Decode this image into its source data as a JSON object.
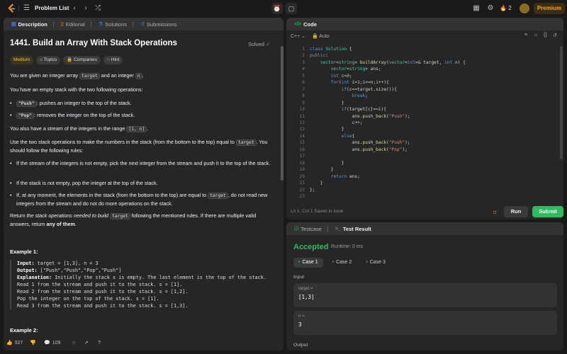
{
  "topbar": {
    "problem_list": "Problem List",
    "streak": "2",
    "premium": "Premium"
  },
  "left": {
    "tabs": [
      "Description",
      "Editorial",
      "Solutions",
      "Submissions"
    ],
    "title": "1441. Build an Array With Stack Operations",
    "solved": "Solved",
    "chips": [
      "Medium",
      "Topics",
      "Companies",
      "Hint"
    ],
    "p1_a": "You are given an integer array ",
    "p1_code1": "target",
    "p1_b": " and an integer ",
    "p1_code2": "n",
    "p1_c": ".",
    "p2": "You have an empty stack with the two following operations:",
    "b1_code": "\"Push\"",
    "b1_text": ": pushes an integer to the top of the stack.",
    "b2_code": "\"Pop\"",
    "b2_text": ": removes the integer on the top of the stack.",
    "p3_a": "You also have a stream of the integers in the range ",
    "p3_code": "[1, n]",
    "p3_b": ".",
    "p4_a": "Use the two stack operations to make the numbers in the stack (from the bottom to the top) equal to ",
    "p4_code": "target",
    "p4_b": ". You should follow the following rules:",
    "r1": "If the stream of the integers is not empty, pick the next integer from the stream and push it to the top of the stack.",
    "r2": "If the stack is not empty, pop the integer at the top of the stack.",
    "r3_a": "If, at any moment, the elements in the stack (from the bottom to the top) are equal to ",
    "r3_code": "target",
    "r3_b": ", do not read new integers from the stream and do not do more operations on the stack.",
    "p5_a": "Return ",
    "p5_em": "the stack operations needed to build ",
    "p5_code": "target",
    "p5_b": " following the mentioned rules. If there are multiple valid answers, return ",
    "p5_strong": "any of them",
    "p5_c": ".",
    "example1_title": "Example 1:",
    "example1_input_label": "Input:",
    "example1_input": " target = [1,3], n = 3",
    "example1_output_label": "Output:",
    "example1_output": " [\"Push\",\"Push\",\"Pop\",\"Push\"]",
    "example1_expl_label": "Explanation:",
    "example1_expl": " Initially the stack s is empty. The last element is the top of the stack.",
    "example1_l1": "Read 1 from the stream and push it to the stack. s = [1].",
    "example1_l2": "Read 2 from the stream and push it to the stack. s = [1,2].",
    "example1_l3": "Pop the integer on the top of the stack. s = [1].",
    "example1_l4": "Read 3 from the stream and push it to the stack. s = [1,3].",
    "example2_title": "Example 2:",
    "likes": "927",
    "comments": "109"
  },
  "code": {
    "tab": "Code",
    "lang": "C++",
    "auto": "Auto",
    "status": "Ln 1, Col 1    Saved to local",
    "run": "Run",
    "submit": "Submit",
    "line_numbers": [
      "1",
      "2",
      "3",
      "4",
      "5",
      "6",
      "7",
      "8",
      "9",
      "10",
      "11",
      "12",
      "13",
      "14",
      "15",
      "16",
      "17",
      "18",
      "19",
      "20",
      "21",
      "22",
      "23"
    ]
  },
  "result": {
    "tabs": [
      "Testcase",
      "Test Result"
    ],
    "accepted": "Accepted",
    "runtime": "Runtime: 0 ms",
    "cases": [
      "Case 1",
      "Case 2",
      "Case 3"
    ],
    "input_label": "Input",
    "target_key": "target =",
    "target_val": "[1,3]",
    "n_key": "n =",
    "n_val": "3",
    "output_label": "Output"
  },
  "colors": {
    "accepted": "#2cbb5d",
    "medium": "#ffc01e",
    "premium": "#ffa116"
  }
}
